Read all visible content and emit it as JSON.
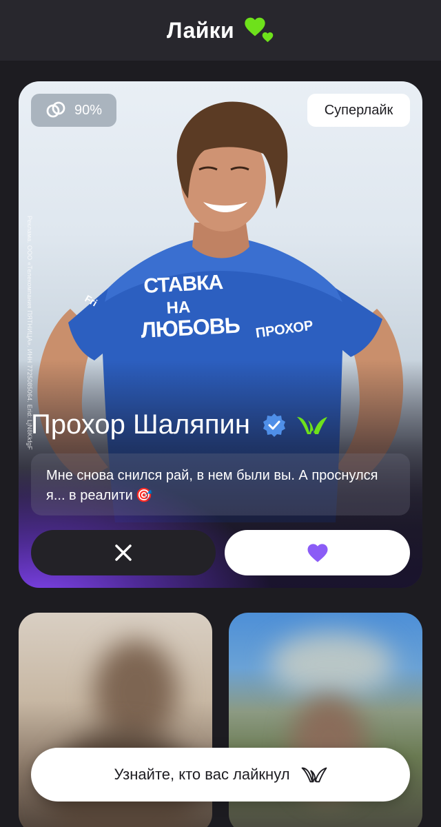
{
  "header": {
    "title": "Лайки",
    "icon": "double-heart-icon",
    "icon_color": "#6ee11b"
  },
  "profile_card": {
    "match_percent": "90%",
    "match_icon": "linked-rings-icon",
    "superlike_label": "Суперлайк",
    "ad_label": "Реклама. ООО «Телекомпания ПЯТНИЦА». ИНН 7725085064. Erid: LjN8KkfgF",
    "name": "Прохор Шаляпин",
    "verified_icon": "verified-badge-icon",
    "verified_color": "#4f8fe8",
    "brand_icon": "w-logo-icon",
    "brand_color": "#6ee11b",
    "bio": "Мне снова снился рай, в нем были вы. А проснулся я... в реалити",
    "bio_emoji": "🎯",
    "dislike_icon": "close-icon",
    "like_icon": "heart-icon",
    "like_color": "#8b5cf6",
    "shirt_text_1": "СТАВКА НА ЛЮБОВЬ",
    "shirt_text_2": "ПРОХОР"
  },
  "cta": {
    "label": "Узнайте, кто вас лайкнул",
    "icon": "w-logo-icon"
  },
  "colors": {
    "background": "#1d1c21",
    "header_bg": "#28272d",
    "accent_green": "#6ee11b",
    "accent_violet": "#8b5cf6"
  }
}
